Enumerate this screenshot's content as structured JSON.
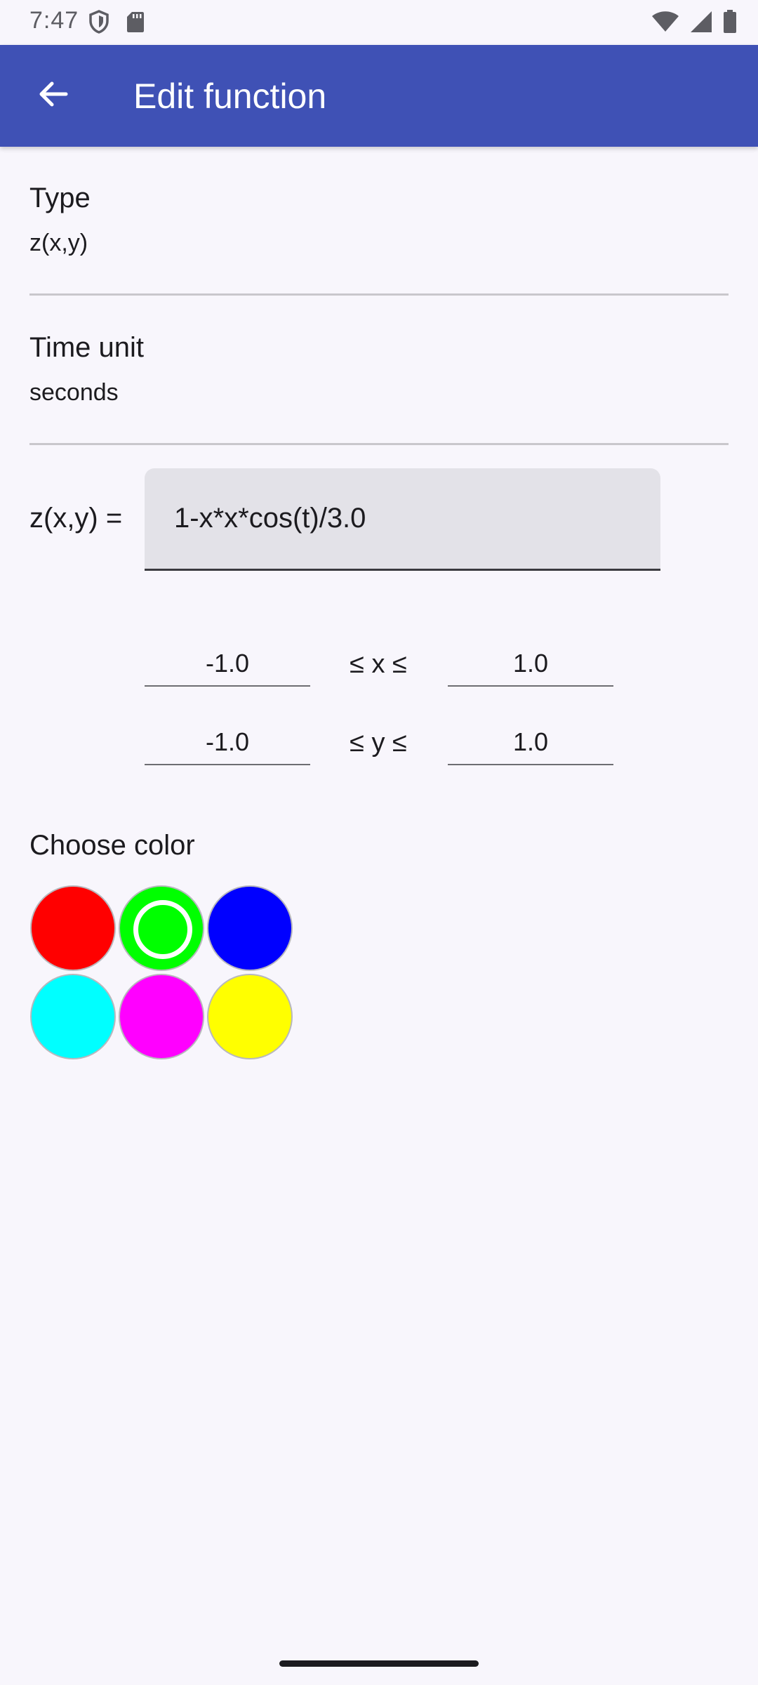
{
  "status_bar": {
    "time": "7:47",
    "left_icons": [
      "shield-icon",
      "sd-card-icon"
    ],
    "right_icons": [
      "wifi-icon",
      "signal-icon",
      "battery-icon"
    ]
  },
  "app_bar": {
    "title": "Edit function",
    "back_icon": "arrow-back-icon",
    "color": "#3f51b5"
  },
  "preferences": {
    "type": {
      "title": "Type",
      "summary": "z(x,y)"
    },
    "time_unit": {
      "title": "Time unit",
      "summary": "seconds"
    }
  },
  "function": {
    "label": "z(x,y) =",
    "value": "1-x*x*cos(t)/3.0"
  },
  "ranges": {
    "x": {
      "min": "-1.0",
      "label": "≤ x ≤",
      "max": "1.0"
    },
    "y": {
      "min": "-1.0",
      "label": "≤ y ≤",
      "max": "1.0"
    }
  },
  "colors": {
    "label": "Choose color",
    "swatches": [
      {
        "name": "red",
        "hex": "#ff0000",
        "selected": false
      },
      {
        "name": "green",
        "hex": "#00ff00",
        "selected": true
      },
      {
        "name": "blue",
        "hex": "#0000ff",
        "selected": false
      },
      {
        "name": "cyan",
        "hex": "#00ffff",
        "selected": false
      },
      {
        "name": "magenta",
        "hex": "#ff00ff",
        "selected": false
      },
      {
        "name": "yellow",
        "hex": "#ffff00",
        "selected": false
      }
    ]
  }
}
